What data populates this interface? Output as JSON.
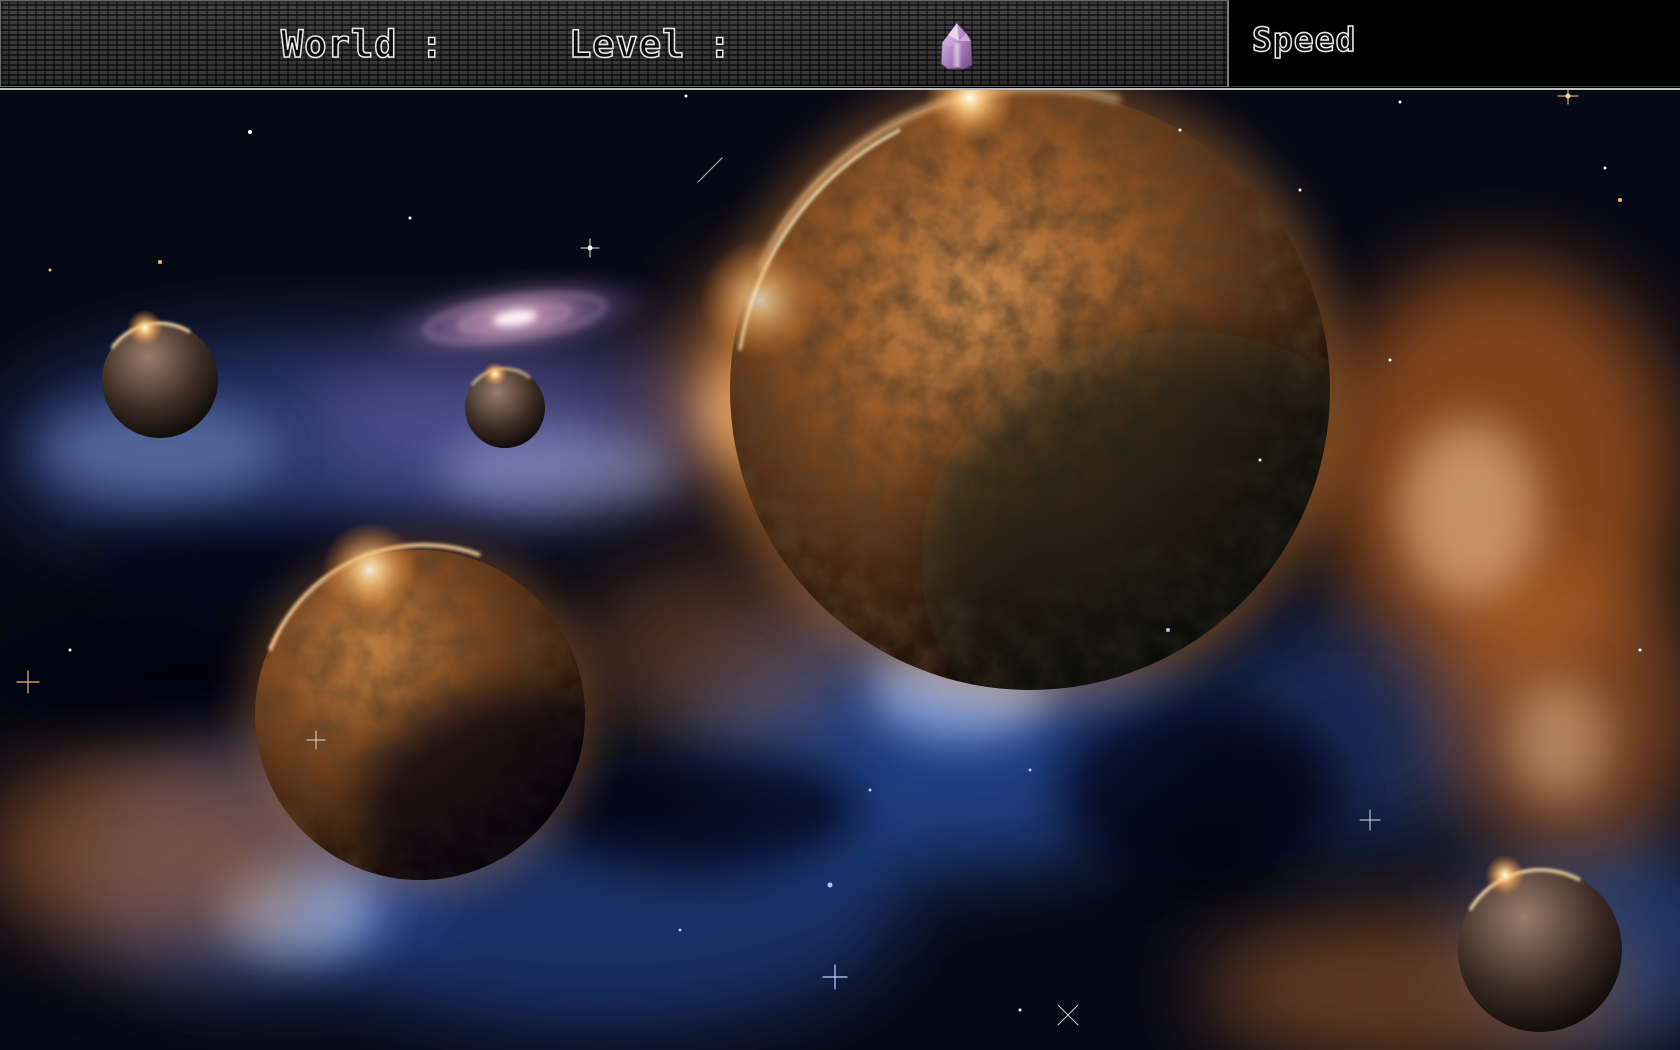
{
  "hud": {
    "world_label": "World :",
    "level_label": "Level :",
    "speed_label": "Speed",
    "crystal_icon": "crystal-gem-icon"
  },
  "scene": {
    "background": "space-nebula-with-planets"
  },
  "colors": {
    "hud_panel": "#2a2a2a",
    "hud_label_outline": "#e8e8e8",
    "nebula_orange": "#e07a2a",
    "nebula_blue": "#3a6bd0",
    "crystal": "#b58bc9"
  }
}
